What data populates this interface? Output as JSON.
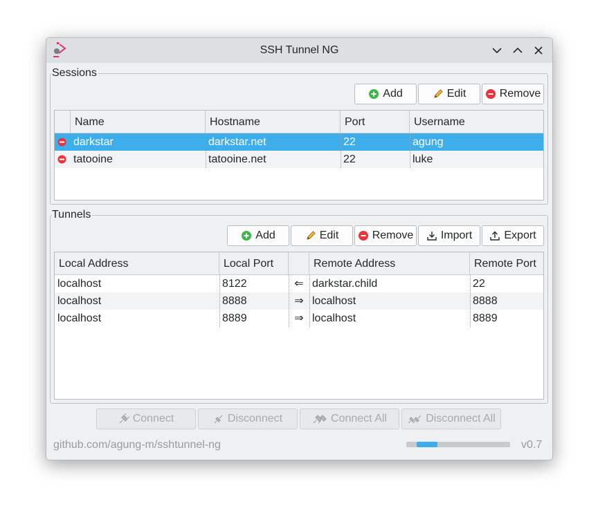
{
  "window": {
    "title": "SSH Tunnel NG"
  },
  "colors": {
    "accent": "#3daee9",
    "remove": "#e8343c",
    "add": "#3fb44a",
    "edit": "#e8a21c"
  },
  "sessions": {
    "label": "Sessions",
    "buttons": {
      "add": "Add",
      "edit": "Edit",
      "remove": "Remove"
    },
    "columns": [
      "",
      "Name",
      "Hostname",
      "Port",
      "Username"
    ],
    "rows": [
      {
        "status": "disconnected",
        "name": "darkstar",
        "hostname": "darkstar.net",
        "port": "22",
        "username": "agung",
        "selected": true
      },
      {
        "status": "disconnected",
        "name": "tatooine",
        "hostname": "tatooine.net",
        "port": "22",
        "username": "luke",
        "selected": false
      }
    ]
  },
  "tunnels": {
    "label": "Tunnels",
    "buttons": {
      "add": "Add",
      "edit": "Edit",
      "remove": "Remove",
      "import": "Import",
      "export": "Export"
    },
    "columns": [
      "Local Address",
      "Local Port",
      "",
      "Remote Address",
      "Remote Port"
    ],
    "rows": [
      {
        "local_address": "localhost",
        "local_port": "8122",
        "direction": "⇐",
        "remote_address": "darkstar.child",
        "remote_port": "22"
      },
      {
        "local_address": "localhost",
        "local_port": "8888",
        "direction": "⇒",
        "remote_address": "localhost",
        "remote_port": "8888"
      },
      {
        "local_address": "localhost",
        "local_port": "8889",
        "direction": "⇒",
        "remote_address": "localhost",
        "remote_port": "8889"
      }
    ]
  },
  "actions": {
    "connect": "Connect",
    "disconnect": "Disconnect",
    "connect_all": "Connect All",
    "disconnect_all": "Disconnect All"
  },
  "footer": {
    "link": "github.com/agung-m/sshtunnel-ng",
    "version": "v0.7",
    "progress": {
      "start": 0.1,
      "end": 0.3
    }
  }
}
